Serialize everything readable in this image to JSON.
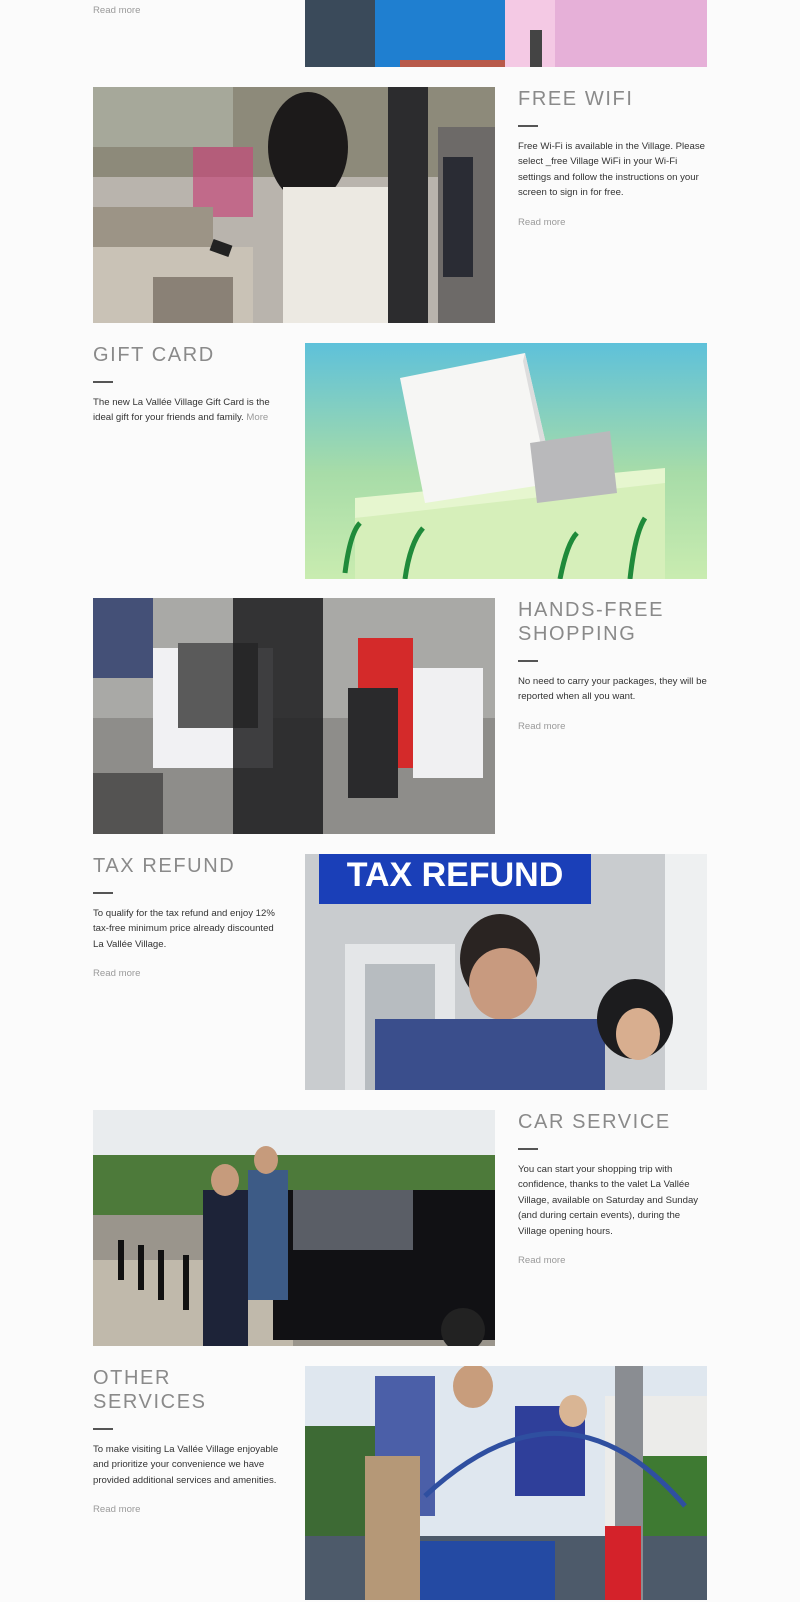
{
  "sections": [
    {
      "read_more": "Read more"
    },
    {
      "title": "FREE WIFI",
      "description": "Free Wi-Fi is available in the Village. Please select _free Village WiFi in your Wi-Fi settings and follow the instructions on your screen to sign in for free.",
      "read_more": "Read more"
    },
    {
      "title": "GIFT CARD",
      "description": "The new La Vallée Village Gift Card is the ideal gift for your friends and family.",
      "more": "More"
    },
    {
      "title": "HANDS-FREE SHOPPING",
      "description": "No need to carry your packages, they will be reported when all you want.",
      "read_more": "Read more"
    },
    {
      "title": "TAX REFUND",
      "description": "To qualify for the tax refund and enjoy 12% tax-free minimum price already discounted La Vallée Village.",
      "read_more": "Read more",
      "sign_text": "TAX REFUND"
    },
    {
      "title": "CAR SERVICE",
      "description": "You can start your shopping trip with confidence, thanks to the valet La Vallée Village, available on Saturday and Sunday (and during certain events), during the Village opening hours.",
      "read_more": "Read more"
    },
    {
      "title": "OTHER SERVICES",
      "description": "To make visiting La Vallée Village enjoyable and prioritize your convenience we have provided additional services and amenities.",
      "read_more": "Read more"
    }
  ]
}
